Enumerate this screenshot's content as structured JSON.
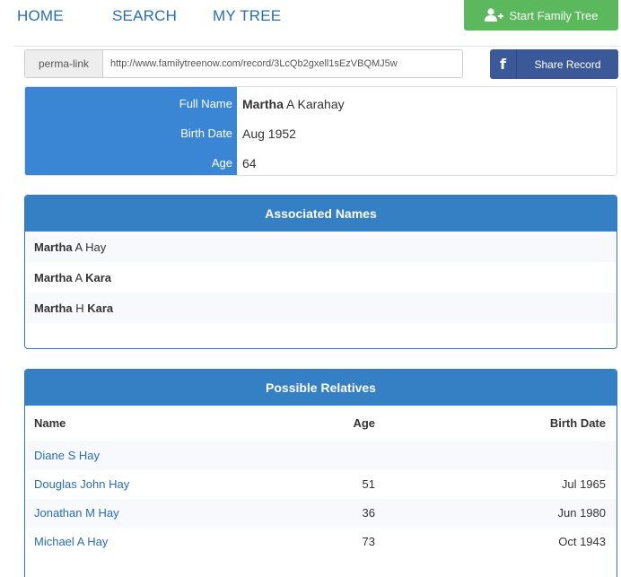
{
  "nav": {
    "home": "HOME",
    "search": "SEARCH",
    "my_tree": "MY TREE",
    "start_button": "Start Family Tree"
  },
  "permalink": {
    "label": "perma-link",
    "url": "http://www.familytreenow.com/record/3LcQb2gxell1sEzVBQMJ5w"
  },
  "share": {
    "icon_letter": "f",
    "label": "Share Record"
  },
  "summary": {
    "full_name_label": "Full Name",
    "first_name": "Martha",
    "rest_name": " A Karahay",
    "birth_date_label": "Birth Date",
    "birth_date": "Aug 1952",
    "age_label": "Age",
    "age": "64"
  },
  "associated_names": {
    "title": "Associated Names",
    "items": [
      {
        "first": "Martha",
        "middle": " A Hay",
        "last": ""
      },
      {
        "first": "Martha",
        "middle": " A ",
        "last": "Kara"
      },
      {
        "first": "Martha",
        "middle": " H ",
        "last": "Kara"
      }
    ]
  },
  "relatives": {
    "title": "Possible Relatives",
    "headers": {
      "name": "Name",
      "age": "Age",
      "birth": "Birth Date"
    },
    "rows": [
      {
        "name": "Diane S Hay",
        "age": "",
        "birth": ""
      },
      {
        "name": "Douglas John Hay",
        "age": "51",
        "birth": "Jul 1965"
      },
      {
        "name": "Jonathan M Hay",
        "age": "36",
        "birth": "Jun 1980"
      },
      {
        "name": "Michael A Hay",
        "age": "73",
        "birth": "Oct 1943"
      }
    ]
  },
  "colors": {
    "accent_blue": "#3580c4",
    "link_blue": "#2a6db0",
    "green": "#5cb85c",
    "facebook": "#3b5998"
  }
}
